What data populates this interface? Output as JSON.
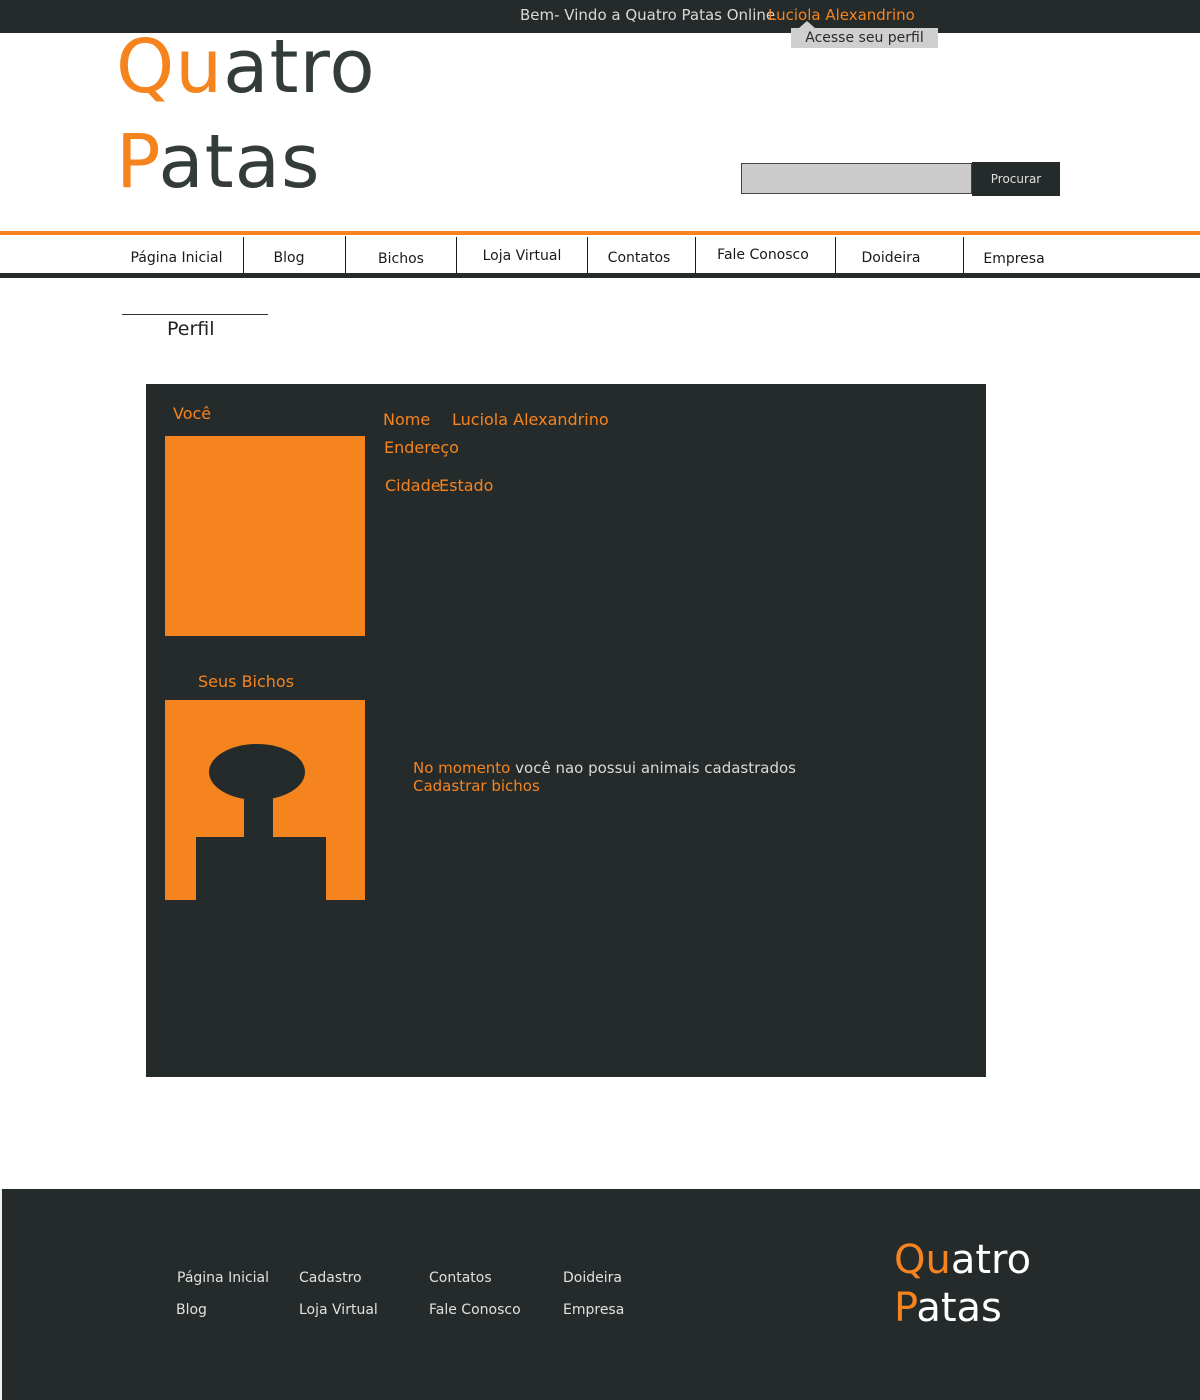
{
  "colors": {
    "accent": "#f5841f",
    "dark": "#252b2b",
    "tooltip": "#cfcfcf",
    "search_field": "#cccccc"
  },
  "topbar": {
    "welcome": "Bem- Vindo a Quatro Patas Online",
    "user_name": "Luciola Alexandrino",
    "profile_tooltip": "Acesse seu perfil"
  },
  "logo": {
    "line1_accent": "Qu",
    "line1_rest": "atro",
    "line2_accent": "P",
    "line2_rest": "atas"
  },
  "search": {
    "value": "",
    "placeholder": "",
    "button_label": "Procurar"
  },
  "nav": {
    "items": [
      {
        "label": "Página Inicial"
      },
      {
        "label": "Blog"
      },
      {
        "label": "Bichos"
      },
      {
        "label": "Loja Virtual"
      },
      {
        "label": "Contatos"
      },
      {
        "label": "Fale Conosco"
      },
      {
        "label": "Doideira"
      },
      {
        "label": "Empresa"
      }
    ]
  },
  "section_title": "Perfil",
  "profile": {
    "you_label": "Você",
    "name_label": "Nome",
    "name_value": "Luciola Alexandrino",
    "address_label": "Endereço",
    "city_label": "Cidade",
    "state_label": "Estado",
    "pets_label": "Seus Bichos",
    "no_pets_highlight": "No momento",
    "no_pets_rest": " você nao possui animais cadastrados",
    "register_pets": "Cadastrar bichos",
    "avatar_icon": "avatar-placeholder",
    "pet_icon": "pet-placeholder-icon"
  },
  "footer": {
    "links": [
      {
        "label": "Página Inicial"
      },
      {
        "label": "Blog"
      },
      {
        "label": "Cadastro"
      },
      {
        "label": "Loja Virtual"
      },
      {
        "label": "Contatos"
      },
      {
        "label": "Fale Conosco"
      },
      {
        "label": "Doideira"
      },
      {
        "label": "Empresa"
      }
    ],
    "logo": {
      "line1_accent": "Qu",
      "line1_rest": "atro",
      "line2_accent": "P",
      "line2_rest": "atas"
    }
  }
}
